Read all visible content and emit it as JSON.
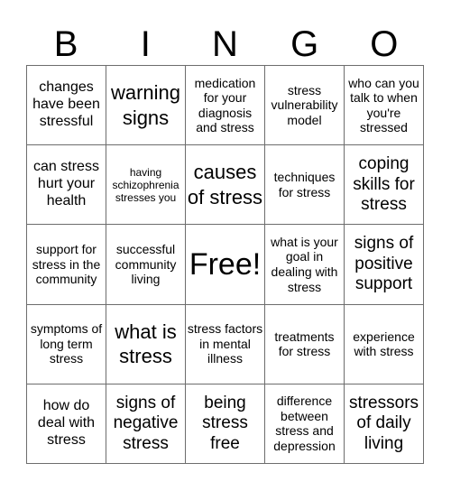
{
  "header": {
    "letters": [
      "B",
      "I",
      "N",
      "G",
      "O"
    ]
  },
  "board": {
    "rows": [
      [
        {
          "text": "changes have been stressful",
          "size": "md"
        },
        {
          "text": "warning signs",
          "size": "xl"
        },
        {
          "text": "medication for your diagnosis and stress",
          "size": "sm"
        },
        {
          "text": "stress vulnerability model",
          "size": "sm"
        },
        {
          "text": "who can you talk to when you're stressed",
          "size": "sm"
        }
      ],
      [
        {
          "text": "can stress hurt your health",
          "size": "md"
        },
        {
          "text": "having schizophrenia stresses you",
          "size": "xs"
        },
        {
          "text": "causes of stress",
          "size": "xl"
        },
        {
          "text": "techniques for stress",
          "size": "sm"
        },
        {
          "text": "coping skills for stress",
          "size": "lg"
        }
      ],
      [
        {
          "text": "support for stress in the community",
          "size": "sm"
        },
        {
          "text": "successful community living",
          "size": "sm"
        },
        {
          "text": "Free!",
          "size": "free"
        },
        {
          "text": "what is your goal in dealing with stress",
          "size": "sm"
        },
        {
          "text": "signs of positive support",
          "size": "lg"
        }
      ],
      [
        {
          "text": "symptoms of long term stress",
          "size": "sm"
        },
        {
          "text": "what is stress",
          "size": "xl"
        },
        {
          "text": "stress factors in mental illness",
          "size": "sm"
        },
        {
          "text": "treatments for stress",
          "size": "sm"
        },
        {
          "text": "experience with stress",
          "size": "sm"
        }
      ],
      [
        {
          "text": "how do deal with stress",
          "size": "md"
        },
        {
          "text": "signs of negative stress",
          "size": "lg"
        },
        {
          "text": "being stress free",
          "size": "lg"
        },
        {
          "text": "difference between stress and depression",
          "size": "sm"
        },
        {
          "text": "stressors of daily living",
          "size": "lg"
        }
      ]
    ]
  }
}
